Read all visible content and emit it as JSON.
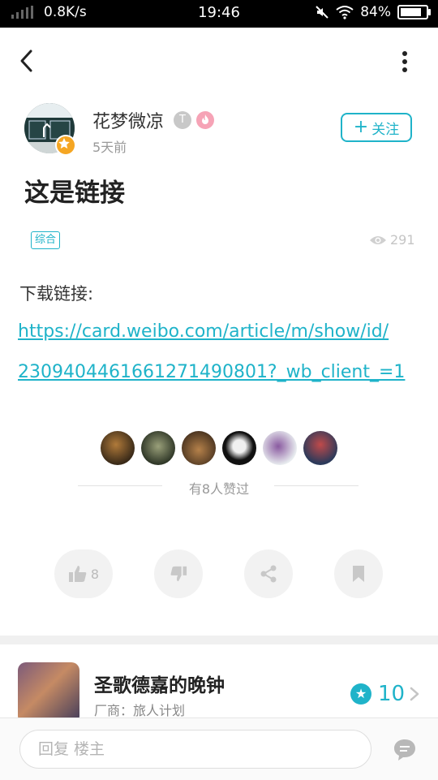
{
  "status": {
    "net_speed": "0.8K/s",
    "time": "19:46",
    "battery": "84%",
    "battery_level": 0.84
  },
  "post": {
    "author": "花梦微凉",
    "level_badge": "T",
    "time_ago": "5天前",
    "follow_label": "关注",
    "title": "这是链接",
    "tag": "综合",
    "views": "291",
    "body_label": "下载链接:",
    "link_line1": "https://card.weibo.com/article/m/show/id/",
    "link_line2": "2309404461661271490801?_wb_client_=1",
    "likers_text": "有8人赞过",
    "like_count": "8"
  },
  "game": {
    "name": "圣歌德嘉的晚钟",
    "vendor": "厂商：旅人计划",
    "score": "10"
  },
  "reply": {
    "placeholder": "回复  楼主"
  },
  "icons": [
    "back-icon",
    "more-icon",
    "eye-icon",
    "thumb-up-icon",
    "thumb-down-icon",
    "share-icon",
    "bookmark-icon",
    "star-icon",
    "chevron-right-icon",
    "comment-icon"
  ],
  "colors": {
    "accent": "#1fb3c9",
    "muted": "#999999"
  }
}
